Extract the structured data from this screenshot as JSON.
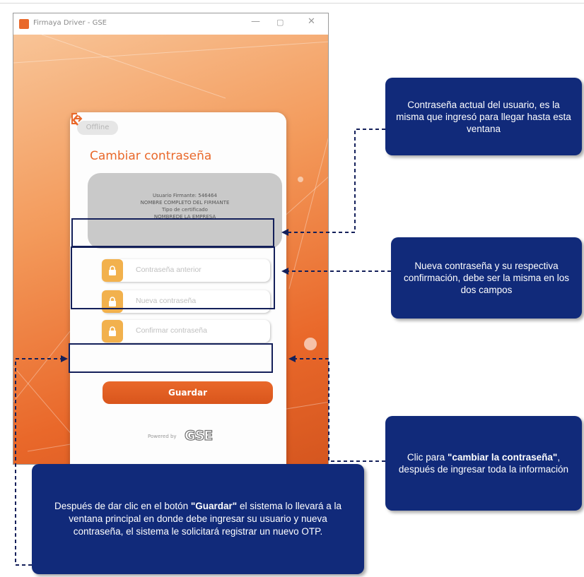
{
  "window": {
    "title": "Firmaya Driver - GSE",
    "controls": {
      "minimize": "—",
      "maximize": "▢",
      "close": "✕"
    }
  },
  "app": {
    "status_badge": "Offline",
    "screen_title": "Cambiar contraseña",
    "info_lines": [
      "Usuario Firmante: 546464",
      "NOMBRE COMPLETO DEL FIRMANTE",
      "Tipo de certificado",
      "NOMBREDE LA EMPRESA"
    ],
    "fields": {
      "old_password_placeholder": "Contraseña anterior",
      "new_password_placeholder": "Nueva contraseña",
      "confirm_password_placeholder": "Confirmar contraseña"
    },
    "save_button": "Guardar",
    "powered_by": "Powered by",
    "brand_logo": "GSE"
  },
  "callouts": {
    "current_password": "Contraseña actual del usuario, es la misma que ingresó para llegar hasta esta ventana",
    "new_password": "Nueva contraseña y su respectiva confirmación, debe ser la misma en los dos campos",
    "save_click": {
      "prefix": "Clic para ",
      "bold": "\"cambiar la contraseña\"",
      "suffix": ", después de ingresar toda la información"
    },
    "after_save": {
      "prefix": "Después de dar clic en el botón ",
      "bold": "\"Guardar\"",
      "suffix": " el sistema lo llevará a la ventana principal en donde debe ingresar su usuario y nueva contraseña, el sistema le solicitará registrar un nuevo OTP."
    }
  },
  "colors": {
    "accent_orange": "#e9682a",
    "callout_navy": "#112a7a",
    "lock_yellow": "#f2b14d",
    "connector": "#14205a"
  }
}
